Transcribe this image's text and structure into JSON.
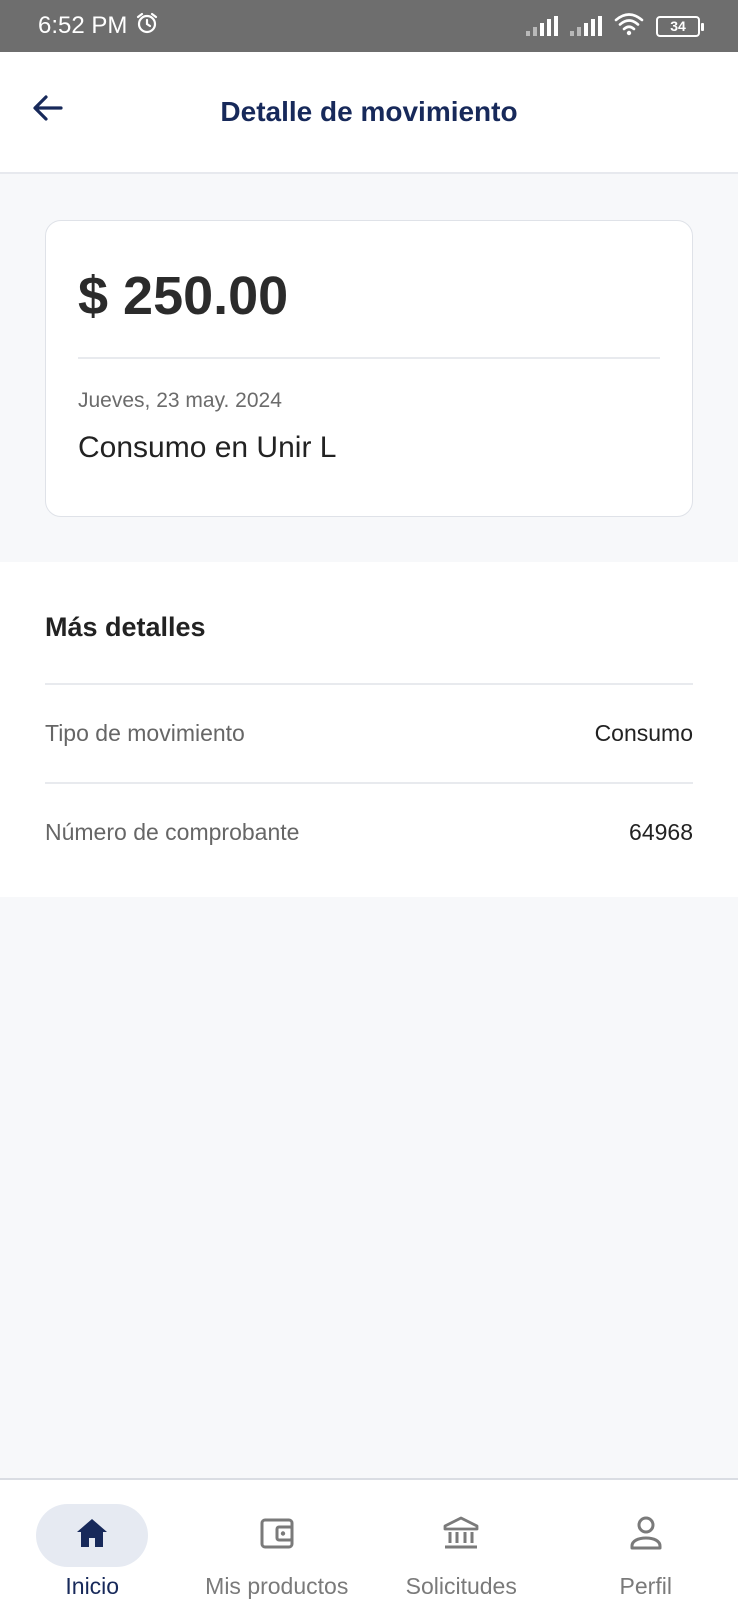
{
  "status_bar": {
    "time": "6:52 PM",
    "battery": "34",
    "icons": [
      "alarm-icon",
      "signal-icon",
      "signal-icon",
      "wifi-icon",
      "battery-icon"
    ]
  },
  "header": {
    "title": "Detalle de movimiento",
    "back_icon": "arrow-left-icon"
  },
  "summary": {
    "amount": "$ 250.00",
    "date": "Jueves, 23 may. 2024",
    "description": "Consumo en Unir L"
  },
  "details": {
    "title": "Más detalles",
    "rows": [
      {
        "label": "Tipo de movimiento",
        "value": "Consumo"
      },
      {
        "label": "Número de comprobante",
        "value": "64968"
      }
    ]
  },
  "bottom_nav": {
    "items": [
      {
        "label": "Inicio",
        "icon": "home-icon",
        "active": true
      },
      {
        "label": "Mis productos",
        "icon": "wallet-icon",
        "active": false
      },
      {
        "label": "Solicitudes",
        "icon": "bank-icon",
        "active": false
      },
      {
        "label": "Perfil",
        "icon": "user-icon",
        "active": false
      }
    ]
  },
  "colors": {
    "brand_navy": "#17295a",
    "background": "#f7f8fa",
    "status_bar": "#6e6e6e"
  }
}
